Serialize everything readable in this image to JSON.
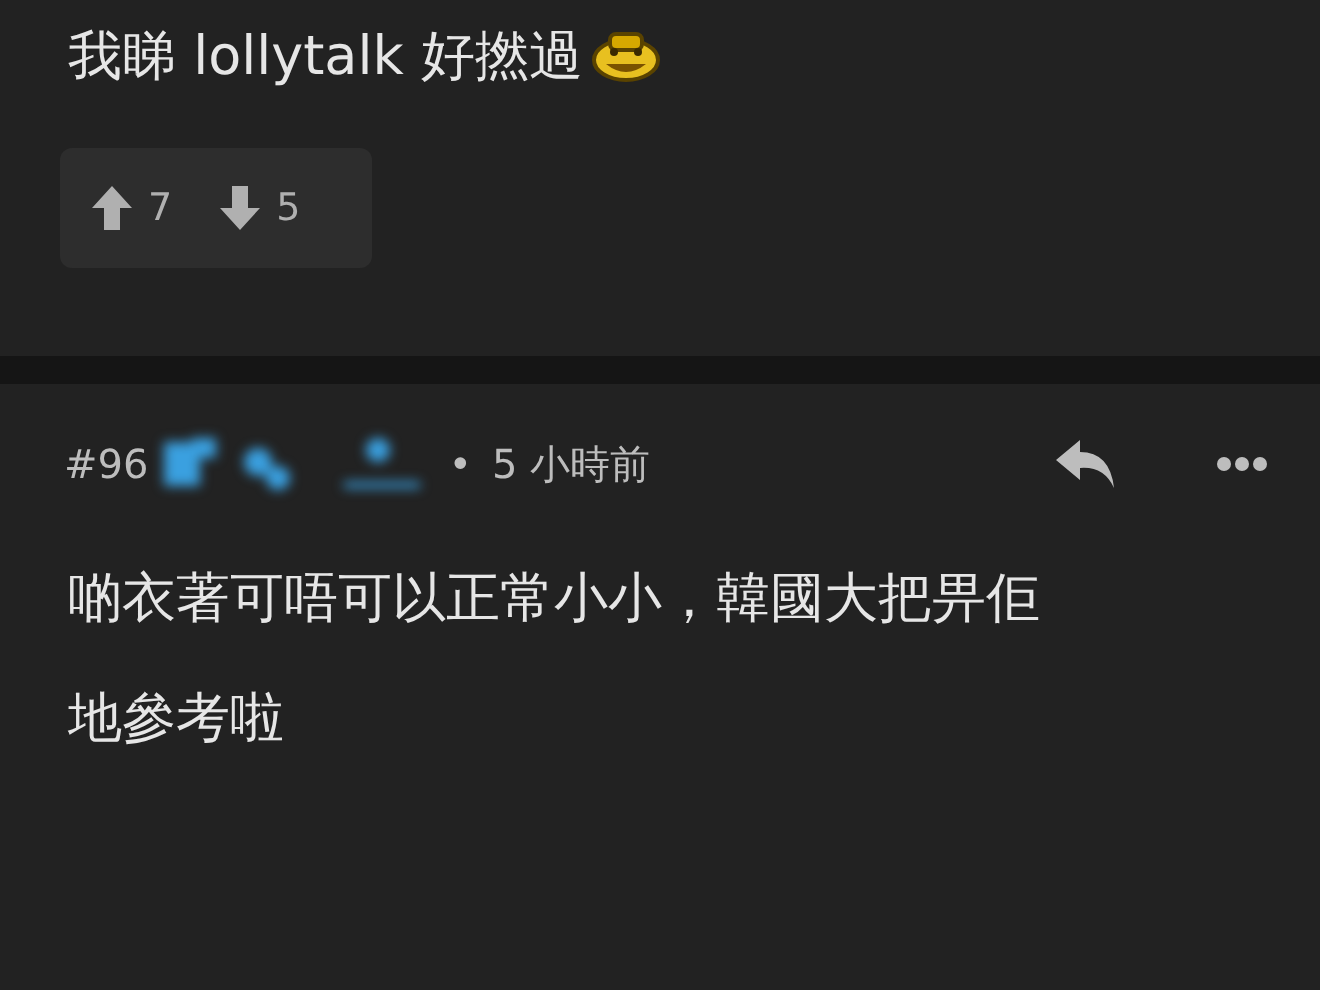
{
  "previous_post": {
    "text": "我睇 lollytalk 好撚過",
    "upvotes": "7",
    "downvotes": "5"
  },
  "post": {
    "number": "#96",
    "time": "5 小時前",
    "separator": "•",
    "lines": [
      "啲衣著可唔可以正常小小，韓國大把畀佢",
      "地參考啦"
    ]
  }
}
